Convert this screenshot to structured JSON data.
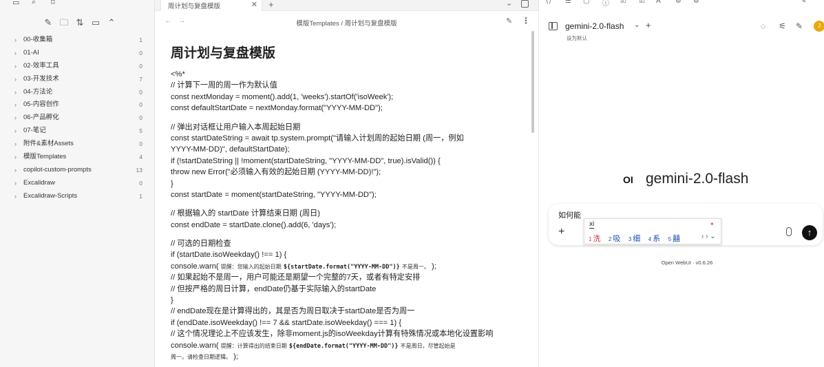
{
  "sidebar": {
    "items": [
      {
        "label": "00-收集箱",
        "count": "1"
      },
      {
        "label": "01-AI",
        "count": "0"
      },
      {
        "label": "02-效率工具",
        "count": "0"
      },
      {
        "label": "03-开发技术",
        "count": "7"
      },
      {
        "label": "04-方法论",
        "count": "0"
      },
      {
        "label": "05-内容创作",
        "count": "0"
      },
      {
        "label": "06-产品孵化",
        "count": "0"
      },
      {
        "label": "07-笔记",
        "count": "5"
      },
      {
        "label": "附件&素材Assets",
        "count": "0"
      },
      {
        "label": "模版Templates",
        "count": "4"
      },
      {
        "label": "copilot-custom-prompts",
        "count": "13"
      },
      {
        "label": "Excalidraw",
        "count": "0"
      },
      {
        "label": "Excalidraw-Scripts",
        "count": "1"
      }
    ]
  },
  "editor": {
    "tab_title": "周计划与复盘模版",
    "breadcrumb": "模版Templates / 周计划与复盘模版",
    "title": "周计划与复盘模版",
    "lines": {
      "l1": "<%*",
      "l2": "// 计算下一周的周一作为默认值",
      "l3": "const nextMonday = moment().add(1, 'weeks').startOf('isoWeek');",
      "l4": "const defaultStartDate = nextMonday.format(\"YYYY-MM-DD\");",
      "l5": "// 弹出对话框让用户输入本周起始日期",
      "l6": "const startDateString = await tp.system.prompt(\"请输入计划周的起始日期 (周一，例如",
      "l7": "YYYY-MM-DD)\", defaultStartDate);",
      "l8": "if (!startDateString || !moment(startDateString, \"YYYY-MM-DD\", true).isValid()) {",
      "l9": "throw new Error(\"必须输入有效的起始日期 (YYYY-MM-DD)!\");",
      "l10": "}",
      "l11": "const startDate = moment(startDateString, \"YYYY-MM-DD\");",
      "l12": "// 根据输入的 startDate 计算结束日期 (周日)",
      "l13": "const endDate = startDate.clone().add(6, 'days');",
      "l14": "// 可选的日期检查",
      "l15": "if (startDate.isoWeekday() !== 1) {",
      "l16a": "console.warn(",
      "l16b": "提醒：您输入的起始日期",
      "l16c": "${startDate.format(\"YYYY-MM-DD\")}",
      "l16d": "不是周一。",
      "l16e": ");",
      "l17": "// 如果起始不是周一，用户可能还是期望一个完整的7天，或者有特定安排",
      "l18": "// 但按严格的周日计算，endDate仍基于实际输入的startDate",
      "l19": "}",
      "l20": "// endDate现在是计算得出的，其是否为周日取决于startDate是否为周一",
      "l21": "if (endDate.isoWeekday() !== 7 && startDate.isoWeekday() === 1) {",
      "l22": "// 这个情况理论上不应该发生，除非moment.js的isoWeekday计算有特殊情况或本地化设置影响",
      "l23a": "console.warn(",
      "l23b": "提醒：计算得出的结束日期",
      "l23c": "${endDate.format(\"YYYY-MM-DD\")}",
      "l23d": "不是周日，尽管起始是",
      "l24a": "周一。请检查日期逻辑。",
      "l24b": ");"
    }
  },
  "chat": {
    "model_name": "gemini-2.0-flash",
    "set_default": "设为默认",
    "hero_logo": "OI",
    "hero_model": "gemini-2.0-flash",
    "input_text": "如何能",
    "ime_composition": "xi",
    "ime_candidates": [
      {
        "n": "1",
        "text": "洗"
      },
      {
        "n": "2",
        "text": "吸"
      },
      {
        "n": "3",
        "text": "细"
      },
      {
        "n": "4",
        "text": "系"
      },
      {
        "n": "5",
        "text": "囍"
      }
    ],
    "footer": "Open WebUI · v0.6.26",
    "avatar_letter": "J"
  },
  "colors": {
    "avatar": "#e9a90c",
    "ime_candidate": "#1a4db3",
    "send_button": "#111111"
  }
}
